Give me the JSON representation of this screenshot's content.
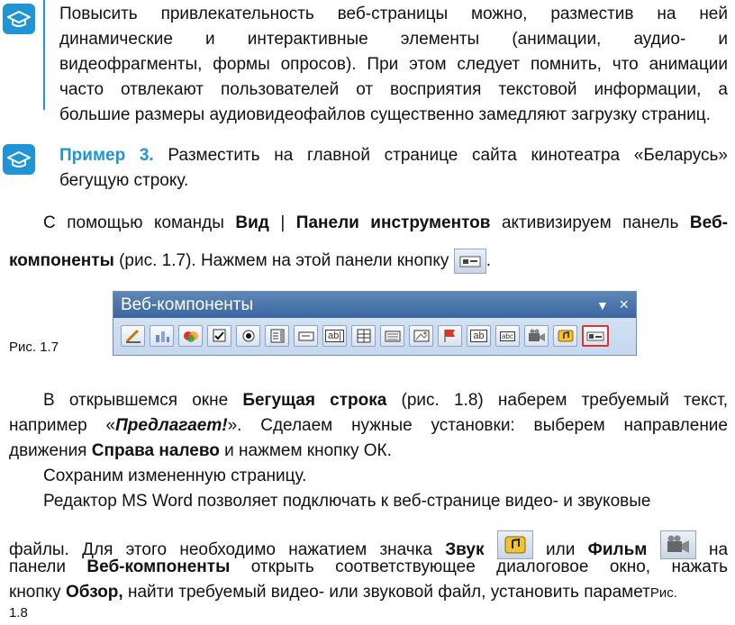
{
  "top_paragraph": {
    "lines": [
      "Повысить привлекательность веб-страницы можно, разместив на ней",
      "динамические и интерактивные элементы (анимации, аудио- и",
      "видеофрагменты, формы опросов). При этом следует помнить, что анимации",
      "часто отвлекают пользователей от восприятия текстовой информации, а",
      "большие размеры аудиовидеофайлов существенно замедляют загрузку страниц."
    ]
  },
  "example": {
    "label": "Пример 3.",
    "line1": "Разместить на главной странице сайта кинотеатра «Беларусь»",
    "line2": "бегущую строку."
  },
  "para1": {
    "a": "С помощью команды ",
    "vid": "Вид",
    "sep": " | ",
    "panels": "Панели инструментов",
    "b": " активизируем панель ",
    "web1": "Веб-",
    "web2": "компоненты",
    "c": " (рис. 1.7). Нажмем на этой панели кнопку ",
    "d": "."
  },
  "toolbar": {
    "title": "Веб-компоненты",
    "dropdown_glyph": "▼",
    "close_glyph": "×",
    "buttons": [
      "pen",
      "chart",
      "bubbles",
      "checkbox",
      "radio",
      "list",
      "field",
      "ab",
      "table",
      "grid",
      "image",
      "flag",
      "ab2",
      "abc",
      "camera",
      "sound",
      "marquee"
    ]
  },
  "figure_caption": "Рис. 1.7",
  "para2": {
    "a": "В открывшемся окне ",
    "marquee": "Бегущая строка",
    "b": " (рис. 1.8) наберем требуемый текст,",
    "c": "например «",
    "offer": "Предлагает!",
    "d": "». Сделаем нужные установки: выберем направление",
    "e": "движения ",
    "dir": "Справа налево",
    "f": " и нажмем кнопку ОК."
  },
  "para3": "Сохраним измененную страницу.",
  "para4": {
    "l1": "Редактор MS Word позволяет подключать к веб-странице видео- и звуковые",
    "l2a": "файлы. Для этого необходимо нажатием значка ",
    "sound": "Звук",
    "l2b": " или ",
    "film": "Фильм",
    "l2c": " на",
    "l3a": "панели ",
    "panel": "Веб-компоненты",
    "l3b": " открыть соответствующее диалоговое окно, нажать",
    "l4a": "кнопку ",
    "browse": "Обзор,",
    "l4b": " найти требуемый видео- или звуковой файл, установить парамет",
    "l4c": "Рис.",
    "l5": "1.8"
  }
}
